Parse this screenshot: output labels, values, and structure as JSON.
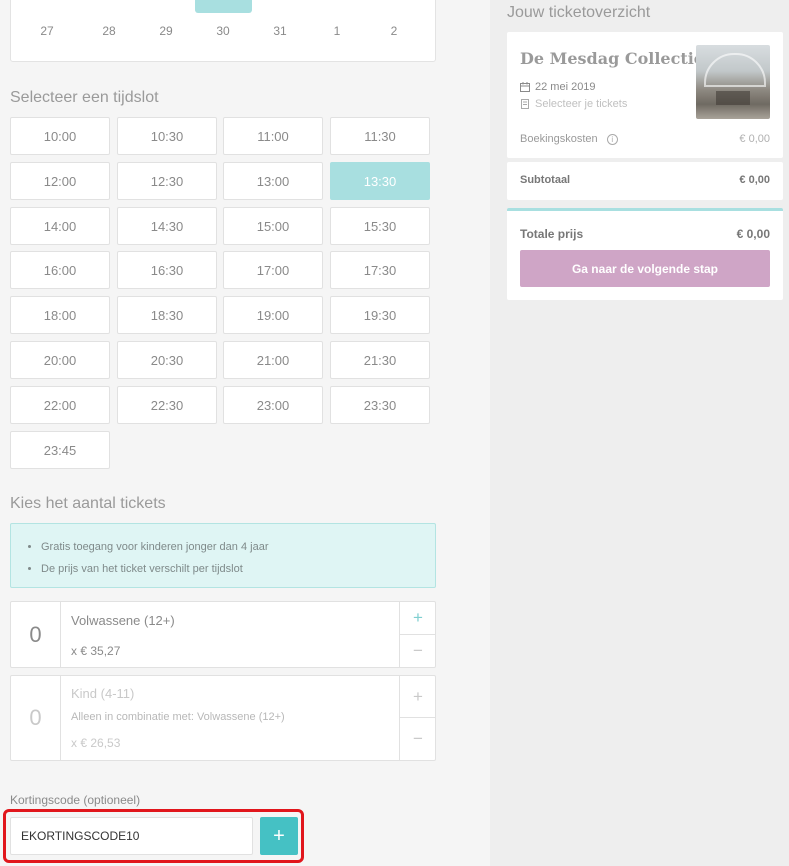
{
  "calendar": {
    "days": [
      "27",
      "28",
      "29",
      "30",
      "31",
      "1",
      "2"
    ]
  },
  "timeslot": {
    "title": "Selecteer een tijdslot",
    "slots": [
      "10:00",
      "10:30",
      "11:00",
      "11:30",
      "12:00",
      "12:30",
      "13:00",
      "13:30",
      "14:00",
      "14:30",
      "15:00",
      "15:30",
      "16:00",
      "16:30",
      "17:00",
      "17:30",
      "18:00",
      "18:30",
      "19:00",
      "19:30",
      "20:00",
      "20:30",
      "21:00",
      "21:30",
      "22:00",
      "22:30",
      "23:00",
      "23:30",
      "23:45"
    ],
    "selected": "13:30"
  },
  "tickets": {
    "title": "Kies het aantal tickets",
    "info": [
      "Gratis toegang voor kinderen jonger dan 4 jaar",
      "De prijs van het ticket verschilt per tijdslot"
    ],
    "adult": {
      "count": "0",
      "name": "Volwassene (12+)",
      "price": "x € 35,27"
    },
    "child": {
      "count": "0",
      "name": "Kind (4-11)",
      "note": "Alleen in combinatie met: Volwassene (12+)",
      "price": "x € 26,53"
    },
    "plus_symbol": "+",
    "minus_symbol": "−"
  },
  "discount": {
    "label": "Kortingscode (optioneel)",
    "value": "EKORTINGSCODE10",
    "add_symbol": "+"
  },
  "overview": {
    "title": "Jouw ticketoverzicht",
    "event_title": "De Mesdag Collectie",
    "date": "22 mei 2019",
    "tickets_hint": "Selecteer je tickets",
    "booking_costs_label": "Boekingskosten",
    "booking_costs_value": "€ 0,00",
    "subtotal_label": "Subtotaal",
    "subtotal_value": "€ 0,00",
    "total_label": "Totale prijs",
    "total_value": "€ 0,00",
    "next_button": "Ga naar de volgende stap"
  },
  "icons": {
    "calendar": "calendar-icon",
    "ticket": "ticket-icon",
    "info": "info-icon"
  },
  "colors": {
    "accent": "#45c1c4",
    "selected_slot": "#a8dfe0",
    "next_button": "#cfa5c6",
    "highlight": "#e1161c"
  }
}
